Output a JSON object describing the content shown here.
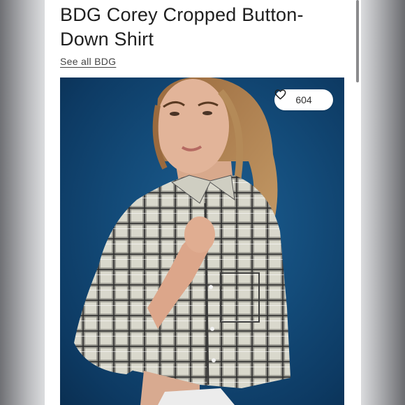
{
  "product": {
    "title": "BDG Corey Cropped Button-Down Shirt",
    "brand_link": "See all BDG"
  },
  "likes": {
    "count": "604",
    "icon": "heart-icon"
  },
  "colors": {
    "backdrop": "#7b7c80",
    "page": "#ffffff",
    "photo_background": "#134b79",
    "text": "#1f1f1f"
  }
}
